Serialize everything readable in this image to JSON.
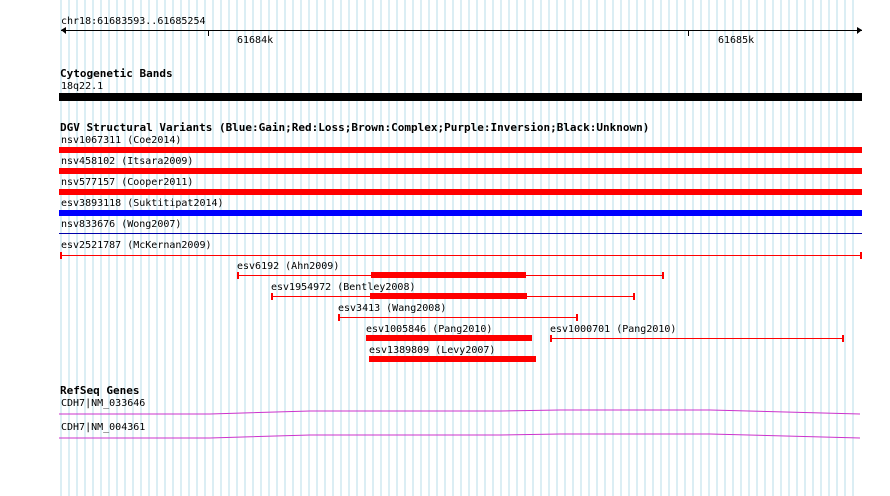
{
  "ruler": {
    "location": "chr18:61683593..61685254",
    "tick_labels": [
      "61684k",
      "61685k"
    ]
  },
  "colors": {
    "gain": "#0000ff",
    "loss": "#ff0000",
    "complex": "#8b4513",
    "inversion": "#800080",
    "unknown": "#000000",
    "gene": "#cc33cc",
    "gridline": "#b7dce8"
  },
  "cytoband": {
    "title": "Cytogenetic Bands",
    "band_label": "18q22.1"
  },
  "dgv": {
    "title": "DGV Structural Variants (Blue:Gain;Red:Loss;Brown:Complex;Purple:Inversion;Black:Unknown)",
    "variants": [
      {
        "label": "nsv1067311 (Coe2014)"
      },
      {
        "label": "nsv458102 (Itsara2009)"
      },
      {
        "label": "nsv577157 (Cooper2011)"
      },
      {
        "label": "esv3893118 (Suktitipat2014)"
      },
      {
        "label": "nsv833676 (Wong2007)"
      },
      {
        "label": "esv2521787 (McKernan2009)"
      },
      {
        "label": "esv6192 (Ahn2009)"
      },
      {
        "label": "esv1954972 (Bentley2008)"
      },
      {
        "label": "esv3413 (Wang2008)"
      },
      {
        "label": "esv1005846 (Pang2010)"
      },
      {
        "label": "esv1000701 (Pang2010)"
      },
      {
        "label": "esv1389809 (Levy2007)"
      }
    ]
  },
  "refseq": {
    "title": "RefSeq Genes",
    "genes": [
      {
        "label": "CDH7|NM_033646"
      },
      {
        "label": "CDH7|NM_004361"
      }
    ]
  }
}
